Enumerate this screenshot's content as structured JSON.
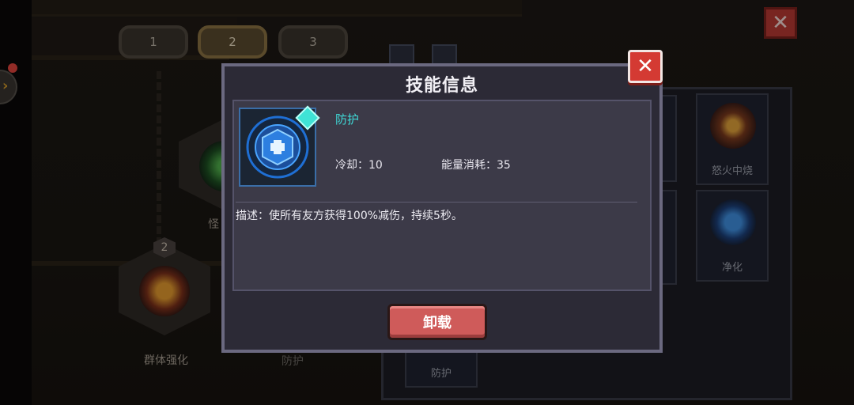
{
  "background": {
    "page_tabs": [
      "1",
      "2",
      "3"
    ],
    "active_page_tab": "2",
    "close_symbol": "✕",
    "nodes": [
      {
        "level": "2",
        "label": "群体强化",
        "icon": "bell-icon"
      },
      {
        "level": "",
        "label": "怪",
        "icon": "green-skill-icon"
      }
    ],
    "bottom_partial_label": "防护",
    "cards": [
      {
        "label": "怒火中烧",
        "icon": "fire-burst-icon",
        "color": "#d0792a"
      },
      {
        "label": "净化",
        "icon": "fist-icon",
        "color": "#2f7ad6"
      },
      {
        "label": "防护",
        "icon": "shield-icon",
        "color": "#2f6fd6"
      }
    ]
  },
  "dialog": {
    "title": "技能信息",
    "close_symbol": "✕",
    "skill": {
      "name": "防护",
      "icon": "shield-icon",
      "cooldown": "冷却：10",
      "energy_cost": "能量消耗：35",
      "description": "描述：使所有友方获得100%减伤，持续5秒。"
    },
    "unload_button": "卸载"
  },
  "colors": {
    "skill_name": "#3fd8d6",
    "close_button": "#d43a33",
    "unload_button": "#cf5b5a"
  }
}
